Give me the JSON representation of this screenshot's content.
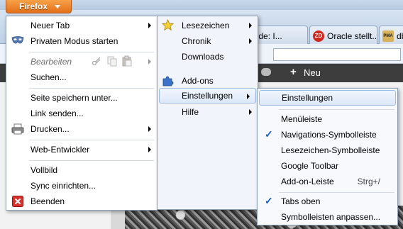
{
  "app_button": {
    "label": "Firefox"
  },
  "background": {
    "tabs": [
      {
        "label": "olem.de: I...",
        "favicon": ""
      },
      {
        "label": "Oracle stellt...",
        "favicon": "ZD"
      },
      {
        "label": "db",
        "favicon": "PMA"
      }
    ],
    "site_toolbar": {
      "new_label": "Neu"
    }
  },
  "main_menu": {
    "new_tab": "Neuer Tab",
    "private_mode": "Privaten Modus starten",
    "edit": "Bearbeiten",
    "find": "Suchen...",
    "save_page": "Seite speichern unter...",
    "send_link": "Link senden...",
    "print": "Drucken...",
    "web_developer": "Web-Entwickler",
    "fullscreen": "Vollbild",
    "sync": "Sync einrichten...",
    "quit": "Beenden"
  },
  "right_menu": {
    "bookmarks": "Lesezeichen",
    "history": "Chronik",
    "downloads": "Downloads",
    "addons": "Add-ons",
    "options": "Einstellungen",
    "help": "Hilfe"
  },
  "options_submenu": {
    "options": "Einstellungen",
    "menu_bar": "Menüleiste",
    "nav_toolbar": "Navigations-Symbolleiste",
    "bookmarks_toolbar": "Lesezeichen-Symbolleiste",
    "google_toolbar": "Google Toolbar",
    "addon_bar": "Add-on-Leiste",
    "addon_bar_shortcut": "Strg+/",
    "tabs_on_top": "Tabs oben",
    "customize": "Symbolleisten anpassen..."
  },
  "colors": {
    "firefox_orange": "#e8791f",
    "highlight": "#dce8f8",
    "checkmark": "#1b5ed1"
  }
}
